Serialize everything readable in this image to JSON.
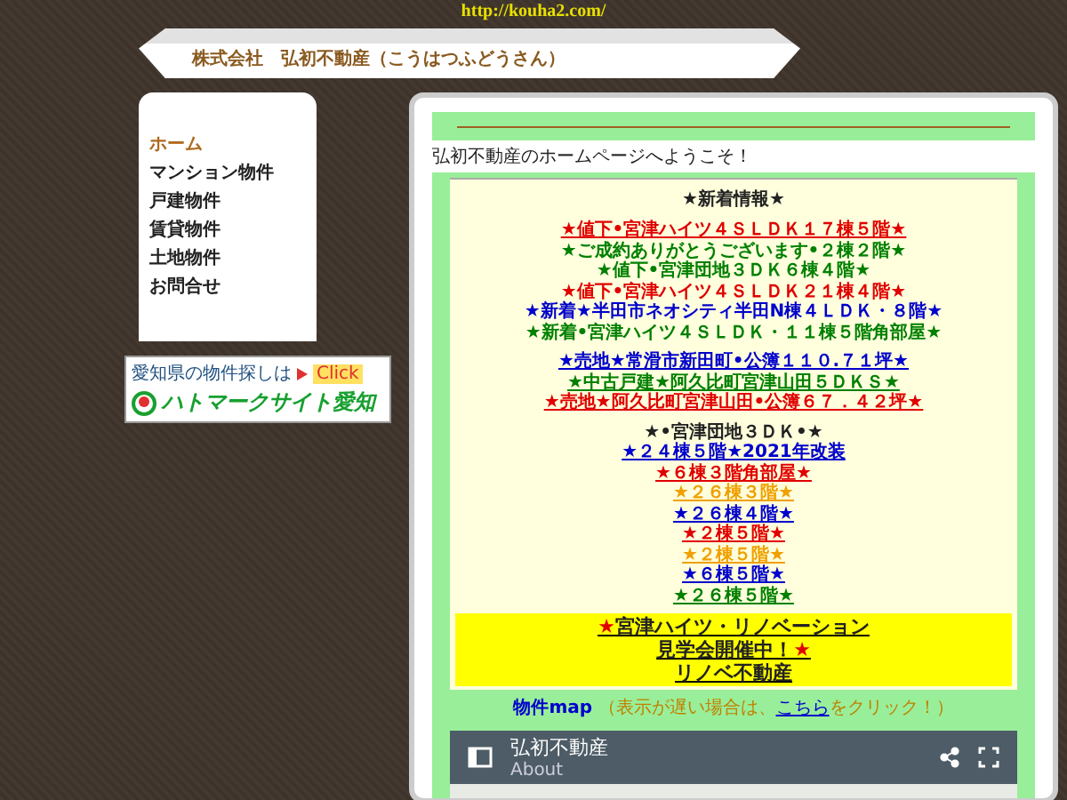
{
  "url": "http://kouha2.com/",
  "title": "株式会社　弘初不動産（こうはつふどうさん）",
  "menu": [
    {
      "label": "ホーム",
      "selected": true
    },
    {
      "label": "マンション物件",
      "selected": false
    },
    {
      "label": "戸建物件",
      "selected": false
    },
    {
      "label": "賃貸物件",
      "selected": false
    },
    {
      "label": "土地物件",
      "selected": false
    },
    {
      "label": "お問合せ",
      "selected": false
    }
  ],
  "banner": {
    "caption": "愛知県の物件探しは",
    "click": "Click",
    "name": "ハトマークサイト愛知"
  },
  "welcome": "弘初不動産のホームページへようこそ！",
  "news": {
    "heading": "★新着情報★",
    "groups": [
      [
        {
          "text": "★値下•宮津ハイツ４ＳＬＤＫ１７棟５階★",
          "color": "#e00000",
          "link": true
        },
        {
          "text": "★ご成約ありがとうございます•２棟２階★",
          "color": "#008000",
          "link": false
        },
        {
          "text": "★値下•宮津団地３ＤＫ６棟４階★",
          "color": "#008000",
          "link": false
        },
        {
          "text": "★値下•宮津ハイツ４ＳＬＤＫ２１棟４階★",
          "color": "#e00000",
          "link": false
        },
        {
          "text": "★新着★半田市ネオシティ半田N棟４ＬＤＫ・８階★",
          "color": "#0000cc",
          "link": false
        },
        {
          "text": "★新着•宮津ハイツ４ＳＬＤＫ・１１棟５階角部屋★",
          "color": "#008000",
          "link": false
        }
      ],
      [
        {
          "text": "★売地★常滑市新田町•公簿１１０.７１坪★",
          "color": "#0000cc",
          "link": true
        },
        {
          "text": "★中古戸建★阿久比町宮津山田５ＤＫＳ★",
          "color": "#008000",
          "link": true
        },
        {
          "text": "★売地★阿久比町宮津山田•公簿６７．４２坪★",
          "color": "#e00000",
          "link": true
        }
      ],
      [
        {
          "text": "★•宮津団地３ＤＫ•★",
          "color": "#222222",
          "link": false
        },
        {
          "text": "★２４棟５階★2021年改装",
          "color": "#0000cc",
          "link": true
        },
        {
          "text": "★６棟３階角部屋★",
          "color": "#e00000",
          "link": true
        },
        {
          "text": "★２６棟３階★",
          "color": "#f0a000",
          "link": true
        },
        {
          "text": "★２６棟４階★",
          "color": "#0000cc",
          "link": true
        },
        {
          "text": "★２棟５階★",
          "color": "#e00000",
          "link": true
        },
        {
          "text": "★２棟５階★",
          "color": "#f0a000",
          "link": true
        },
        {
          "text": "★６棟５階★",
          "color": "#0000cc",
          "link": true
        },
        {
          "text": "★２６棟５階★",
          "color": "#008000",
          "link": true
        }
      ]
    ]
  },
  "promo": [
    [
      {
        "text": "★",
        "color": "#e00000"
      },
      {
        "text": "宮津ハイツ・リノベーション",
        "color": "#222222"
      }
    ],
    [
      {
        "text": "見学会開催中！",
        "color": "#222222"
      },
      {
        "text": "★",
        "color": "#e00000"
      }
    ],
    [
      {
        "text": "リノベ不動産",
        "color": "#222222"
      }
    ]
  ],
  "map_link": {
    "label": "物件map",
    "note": "（表示が遅い場合は、",
    "link": "こちら",
    "note_end": "をクリック！）"
  },
  "map": {
    "title": "弘初不動産",
    "about": "About"
  }
}
